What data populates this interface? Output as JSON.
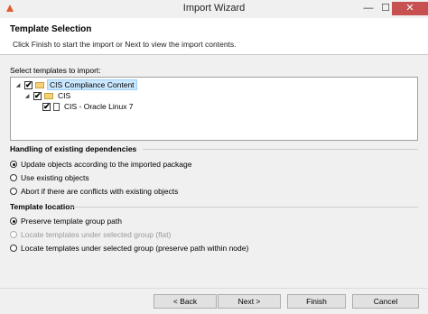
{
  "window": {
    "title": "Import Wizard",
    "controls": {
      "minimize": "—",
      "maximize": "☐",
      "close": "✕"
    }
  },
  "header": {
    "title": "Template Selection",
    "subtitle": "Click Finish to start the import or Next to view the import contents."
  },
  "tree": {
    "label": "Select templates to import:",
    "nodes": [
      {
        "label": "CIS Compliance Content",
        "checked": true,
        "expanded": true,
        "icon": "folder-icon",
        "selected": true
      },
      {
        "label": "CIS",
        "checked": true,
        "expanded": true,
        "icon": "folder-icon"
      },
      {
        "label": "CIS - Oracle Linux 7",
        "checked": true,
        "icon": "document-icon"
      }
    ],
    "check_mark": "✔",
    "expander": "◢"
  },
  "dependencies": {
    "title": "Handling of existing dependencies",
    "options": [
      {
        "label": "Update objects according to the imported package",
        "checked": true,
        "enabled": true
      },
      {
        "label": "Use existing objects",
        "checked": false,
        "enabled": true
      },
      {
        "label": "Abort if there are conflicts with existing objects",
        "checked": false,
        "enabled": true
      }
    ]
  },
  "location": {
    "title": "Template location",
    "options": [
      {
        "label": "Preserve template group path",
        "checked": true,
        "enabled": true
      },
      {
        "label": "Locate templates under selected group (flat)",
        "checked": false,
        "enabled": false
      },
      {
        "label": "Locate templates under selected group (preserve path within node)",
        "checked": false,
        "enabled": true
      }
    ]
  },
  "buttons": {
    "back": "< Back",
    "next": "Next >",
    "finish": "Finish",
    "cancel": "Cancel"
  },
  "colors": {
    "close_button": "#c75050",
    "selection": "#cce8ff",
    "app_icon": "#e25b2a"
  }
}
